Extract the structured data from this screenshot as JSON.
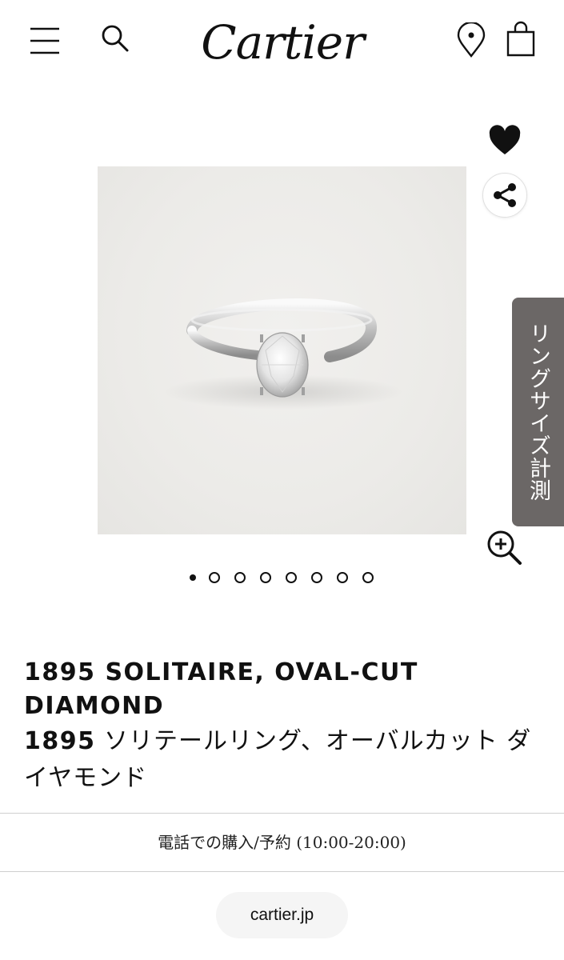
{
  "header": {
    "menu_icon": "hamburger-menu-icon",
    "search_icon": "search-icon",
    "logo": "Cartier",
    "location_icon": "map-pin-icon",
    "bag_icon": "shopping-bag-icon"
  },
  "product": {
    "actions": {
      "wishlist_icon": "heart-icon",
      "share_icon": "share-icon",
      "zoom_icon": "zoom-in-icon"
    },
    "ring_size_tab": "リングサイズ計測",
    "gallery": {
      "count": 8,
      "active_index": 0
    },
    "title_en": "1895 SOLITAIRE, OVAL-CUT DIAMOND",
    "title_jp_number": "1895",
    "title_jp_text": " ソリテールリング、オーバルカット ダイヤモンド"
  },
  "phone_purchase": "電話での購入/予約 (10:00-20:00)",
  "site_link": "cartier.jp",
  "colors": {
    "text": "#111111",
    "tab_background": "#6b6766",
    "image_background": "#ecebe8",
    "divider": "#cfcfcf"
  }
}
